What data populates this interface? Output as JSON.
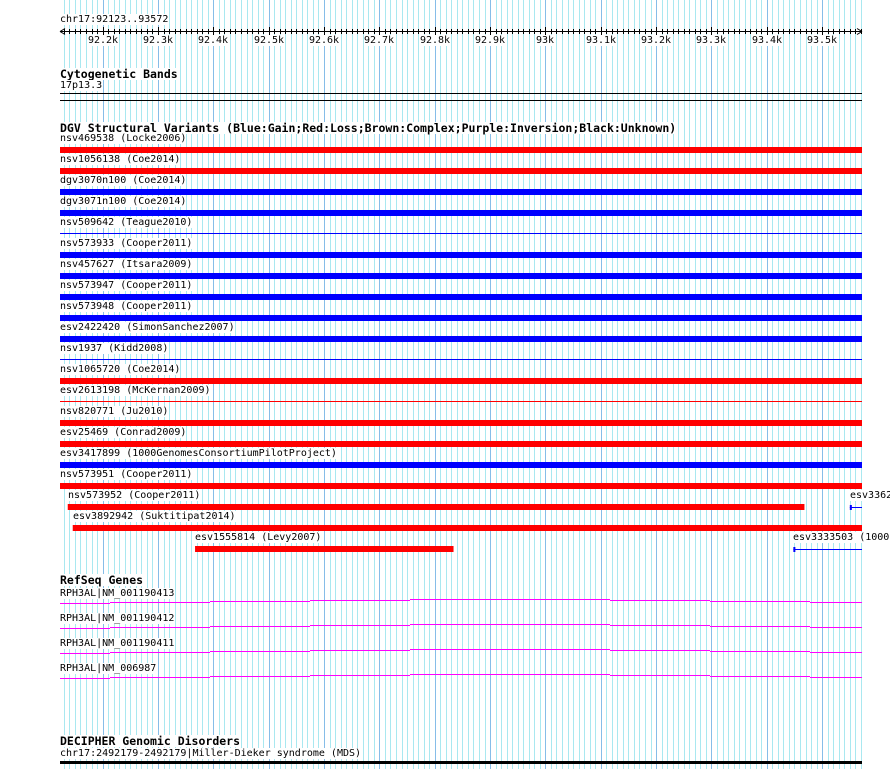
{
  "ruler": {
    "label": "chr17:92123..93572",
    "start": 92123,
    "end": 93572,
    "tick_labels": [
      "92.2k",
      "92.3k",
      "92.4k",
      "92.5k",
      "92.6k",
      "92.7k",
      "92.8k",
      "92.9k",
      "93k",
      "93.1k",
      "93.2k",
      "93.3k",
      "93.4k",
      "93.5k"
    ]
  },
  "colors": {
    "gain": "#0000ff",
    "loss": "#ff0000",
    "gene": "#ff00ff",
    "grid_minor": "#a9e8f0",
    "grid_major": "#86bde8"
  },
  "cytobands": {
    "title": "Cytogenetic Bands",
    "band": "17p13.3"
  },
  "dgv": {
    "title": "DGV Structural Variants (Blue:Gain;Red:Loss;Brown:Complex;Purple:Inversion;Black:Unknown)",
    "rows": [
      [
        {
          "label": "nsv469538 (Locke2006)",
          "type": "loss",
          "style": "thick",
          "start": 92123,
          "end": 93572
        }
      ],
      [
        {
          "label": "nsv1056138 (Coe2014)",
          "type": "loss",
          "style": "thick",
          "start": 92123,
          "end": 93572
        }
      ],
      [
        {
          "label": "dgv3070n100 (Coe2014)",
          "type": "gain",
          "style": "thick",
          "start": 92123,
          "end": 93572
        }
      ],
      [
        {
          "label": "dgv3071n100 (Coe2014)",
          "type": "gain",
          "style": "thick",
          "start": 92123,
          "end": 93572
        }
      ],
      [
        {
          "label": "nsv509642 (Teague2010)",
          "type": "gain",
          "style": "thin",
          "start": 92123,
          "end": 93572
        }
      ],
      [
        {
          "label": "nsv573933 (Cooper2011)",
          "type": "gain",
          "style": "thick",
          "start": 92123,
          "end": 93572
        }
      ],
      [
        {
          "label": "nsv457627 (Itsara2009)",
          "type": "gain",
          "style": "thick",
          "start": 92123,
          "end": 93572
        }
      ],
      [
        {
          "label": "nsv573947 (Cooper2011)",
          "type": "gain",
          "style": "thick",
          "start": 92123,
          "end": 93572
        }
      ],
      [
        {
          "label": "nsv573948 (Cooper2011)",
          "type": "gain",
          "style": "thick",
          "start": 92123,
          "end": 93572
        }
      ],
      [
        {
          "label": "esv2422420 (SimonSanchez2007)",
          "type": "gain",
          "style": "thick",
          "start": 92123,
          "end": 93572
        }
      ],
      [
        {
          "label": "nsv1937 (Kidd2008)",
          "type": "gain",
          "style": "thin",
          "start": 92123,
          "end": 93572
        }
      ],
      [
        {
          "label": "nsv1065720 (Coe2014)",
          "type": "loss",
          "style": "thick",
          "start": 92123,
          "end": 93572
        }
      ],
      [
        {
          "label": "esv2613198 (McKernan2009)",
          "type": "loss",
          "style": "thin",
          "start": 92123,
          "end": 93572
        }
      ],
      [
        {
          "label": "nsv820771 (Ju2010)",
          "type": "loss",
          "style": "thick",
          "start": 92123,
          "end": 93572
        }
      ],
      [
        {
          "label": "esv25469 (Conrad2009)",
          "type": "loss",
          "style": "thick",
          "start": 92123,
          "end": 93572
        }
      ],
      [
        {
          "label": "esv3417899 (1000GenomesConsortiumPilotProject)",
          "type": "gain",
          "style": "thick",
          "start": 92123,
          "end": 93572
        }
      ],
      [
        {
          "label": "nsv573951 (Cooper2011)",
          "type": "loss",
          "style": "thick",
          "start": 92123,
          "end": 93572
        }
      ],
      [
        {
          "label": "nsv573952 (Cooper2011)",
          "type": "loss",
          "style": "thick",
          "start": 92137,
          "end": 93468
        },
        {
          "label": "esv3362",
          "type": "gain",
          "style": "point",
          "start": 93550,
          "end": 93572
        }
      ],
      [
        {
          "label": "esv3892942 (Suktitipat2014)",
          "type": "loss",
          "style": "thick",
          "start": 92146,
          "end": 93572
        }
      ],
      [
        {
          "label": "esv1555814 (Levy2007)",
          "type": "loss",
          "style": "thick",
          "start": 92367,
          "end": 92834
        },
        {
          "label": "esv3333503 (1000",
          "type": "gain",
          "style": "point",
          "start": 93448,
          "end": 93572
        }
      ]
    ]
  },
  "refseq": {
    "title": "RefSeq Genes",
    "genes": [
      "RPH3AL|NM_001190413",
      "RPH3AL|NM_001190412",
      "RPH3AL|NM_001190411",
      "RPH3AL|NM_006987"
    ]
  },
  "decipher": {
    "title": "DECIPHER Genomic Disorders",
    "item": "chr17:2492179-2492179|Miller-Dieker syndrome (MDS)"
  }
}
